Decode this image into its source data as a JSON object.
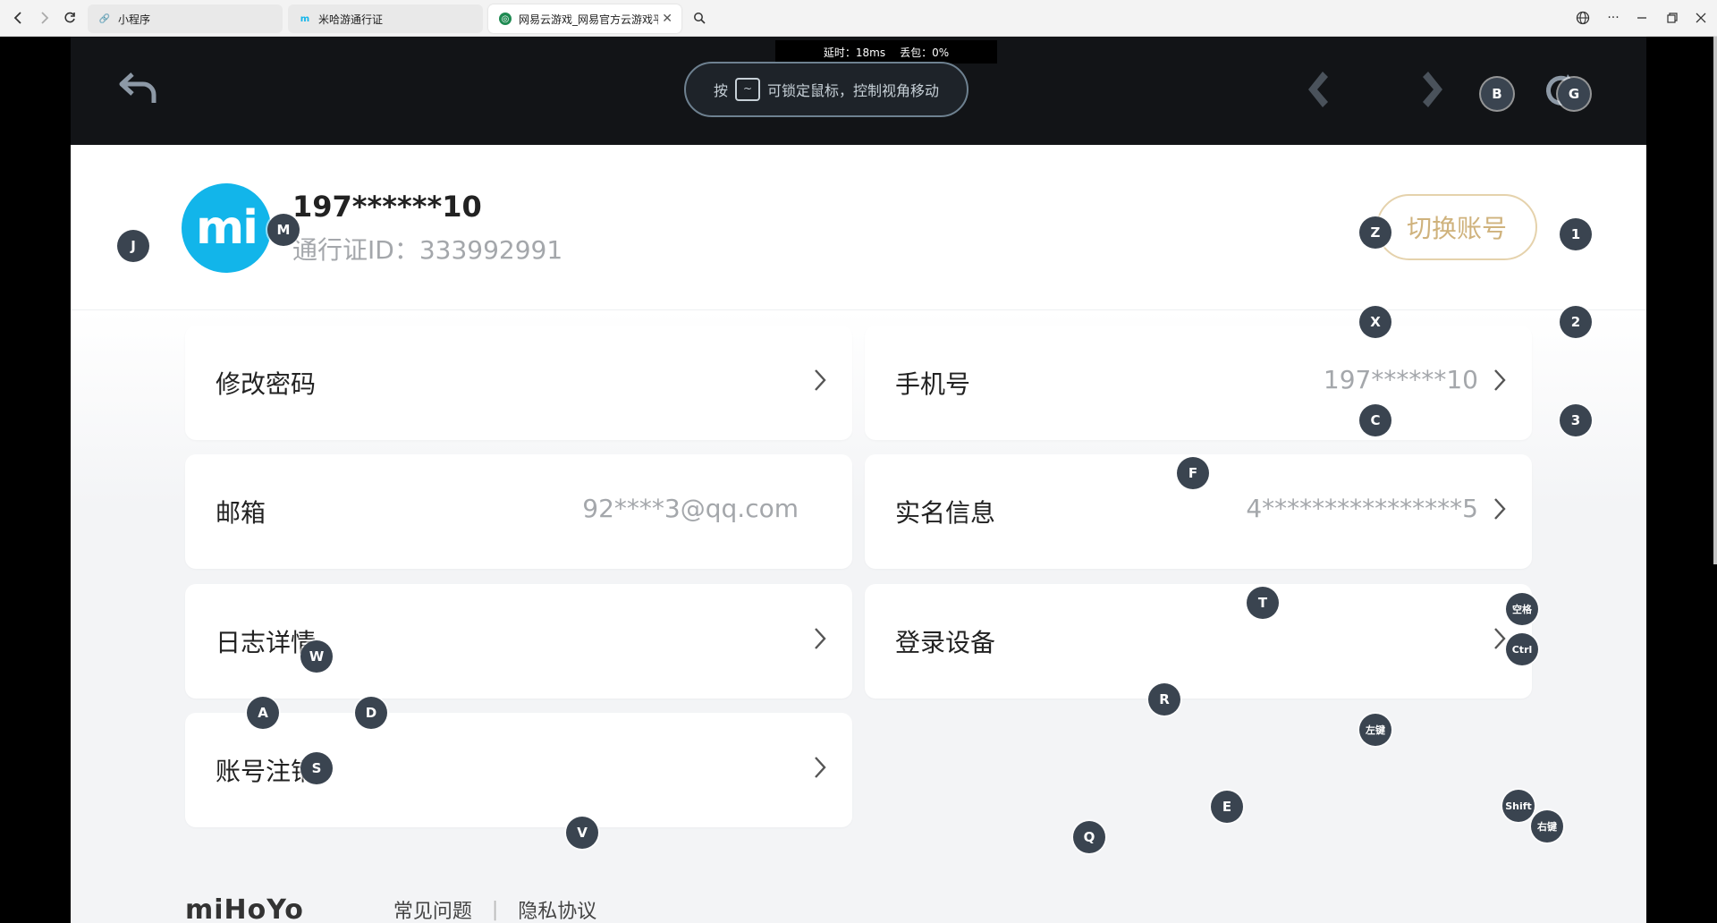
{
  "browser": {
    "tabs": [
      {
        "label": "小程序",
        "icon": "link-icon"
      },
      {
        "label": "米哈游通行证",
        "icon": "mihoyo-icon"
      },
      {
        "label": "网易云游戏_网易官方云游戏平",
        "icon": "netease-cloud-icon"
      }
    ],
    "active_tab": 2
  },
  "toolbar": {
    "latency_label": "延时：18ms",
    "packet_loss_label": "丢包：0%",
    "hint_prefix": "按",
    "hint_key": "~",
    "hint_text": "可锁定鼠标，控制视角移动"
  },
  "account": {
    "avatar_text": "mi",
    "name": "197******10",
    "pass_id": "通行证ID：333992991",
    "switch_label": "切换账号"
  },
  "cards": [
    {
      "label": "修改密码",
      "value": "",
      "arrow": true
    },
    {
      "label": "手机号",
      "value": "197******10",
      "arrow": true
    },
    {
      "label": "邮箱",
      "value": "92****3@qq.com",
      "arrow": false
    },
    {
      "label": "实名信息",
      "value": "4****************5",
      "arrow": true
    },
    {
      "label": "日志详情",
      "value": "",
      "arrow": true
    },
    {
      "label": "登录设备",
      "value": "",
      "arrow": true
    },
    {
      "label": "账号注销",
      "value": "",
      "arrow": true
    }
  ],
  "footer": {
    "logo": "miHoYo",
    "links": [
      "常见问题",
      "隐私协议"
    ]
  },
  "key_overlay": [
    "J",
    "M",
    "Z",
    "1",
    "X",
    "2",
    "C",
    "3",
    "F",
    "T",
    "空格",
    "Ctrl",
    "W",
    "A",
    "D",
    "R",
    "左键",
    "S",
    "E",
    "Shift",
    "右键",
    "V",
    "Q",
    "B",
    "G"
  ],
  "colors": {
    "accent_blue": "#12b5ea",
    "switch_gold": "#cfb27c",
    "toolbar_bg": "#121417",
    "key_bubble": "#3a4450"
  }
}
